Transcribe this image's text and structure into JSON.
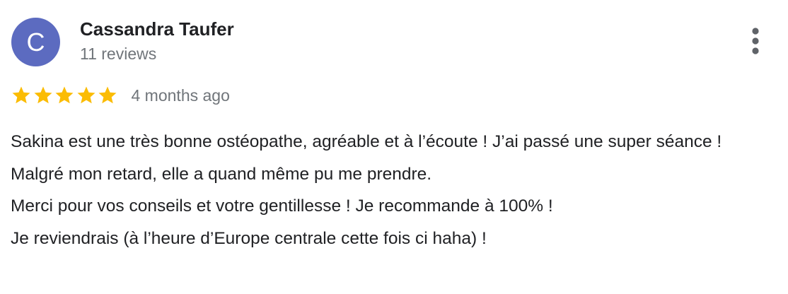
{
  "reviewer": {
    "initial": "C",
    "name": "Cassandra Taufer",
    "review_count": "11 reviews",
    "avatar_color": "#5c6bc0"
  },
  "menu": {
    "icon": "more-vert-icon"
  },
  "rating": {
    "stars": 5,
    "max_stars": 5,
    "star_color": "#fbbc04",
    "date": "4 months ago"
  },
  "review": {
    "lines": [
      "Sakina est une très bonne ostéopathe, agréable et à l’écoute ! J’ai passé une super séance !",
      "Malgré mon retard, elle a quand même pu me prendre.",
      "Merci pour vos conseils et votre gentillesse ! Je recommande à 100% !",
      "Je reviendrais (à l’heure d’Europe centrale cette fois ci haha) !"
    ]
  }
}
